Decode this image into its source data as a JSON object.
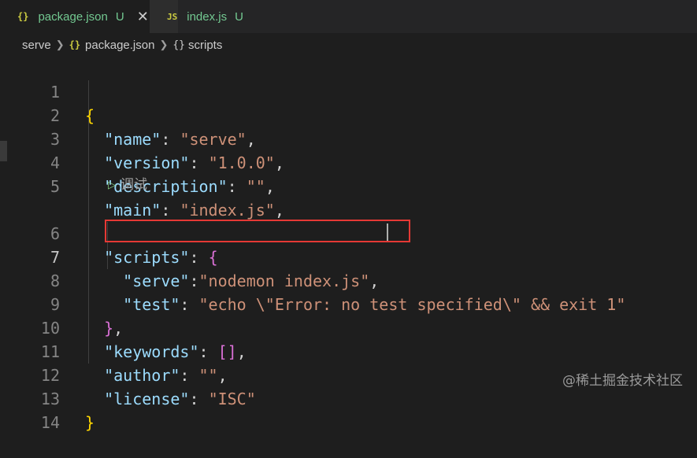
{
  "tabs": [
    {
      "icon": "{}",
      "label": "package.json",
      "status": "U",
      "close": "✕"
    },
    {
      "icon": "JS",
      "label": "index.js",
      "status": "U"
    }
  ],
  "breadcrumb": {
    "root": "serve",
    "file_icon": "{}",
    "file": "package.json",
    "symbol_icon": "{}",
    "symbol": "scripts"
  },
  "codelens": {
    "label": "调试"
  },
  "lines": [
    {
      "num": "1"
    },
    {
      "num": "2",
      "key": "\"name\"",
      "val": "\"serve\""
    },
    {
      "num": "3",
      "key": "\"version\"",
      "val": "\"1.0.0\""
    },
    {
      "num": "4",
      "key": "\"description\"",
      "val": "\"\""
    },
    {
      "num": "5",
      "key": "\"main\"",
      "val": "\"index.js\""
    },
    {
      "num": "6",
      "key": "\"scripts\""
    },
    {
      "num": "7",
      "key": "\"serve\"",
      "val": "\"nodemon index.js\""
    },
    {
      "num": "8",
      "key": "\"test\"",
      "val": "\"echo \\\"Error: no test specified\\\" && exit 1\""
    },
    {
      "num": "9"
    },
    {
      "num": "10",
      "key": "\"keywords\""
    },
    {
      "num": "11",
      "key": "\"author\"",
      "val": "\"\""
    },
    {
      "num": "12",
      "key": "\"license\"",
      "val": "\"ISC\""
    },
    {
      "num": "13"
    },
    {
      "num": "14"
    }
  ],
  "watermark": "@稀土掘金技术社区",
  "colors": {
    "key": "#9cdcfe",
    "string": "#ce9178",
    "brace": "#ffd700",
    "bracket_purple": "#da70d6",
    "untracked": "#73c991",
    "highlight_border": "#e53935"
  }
}
